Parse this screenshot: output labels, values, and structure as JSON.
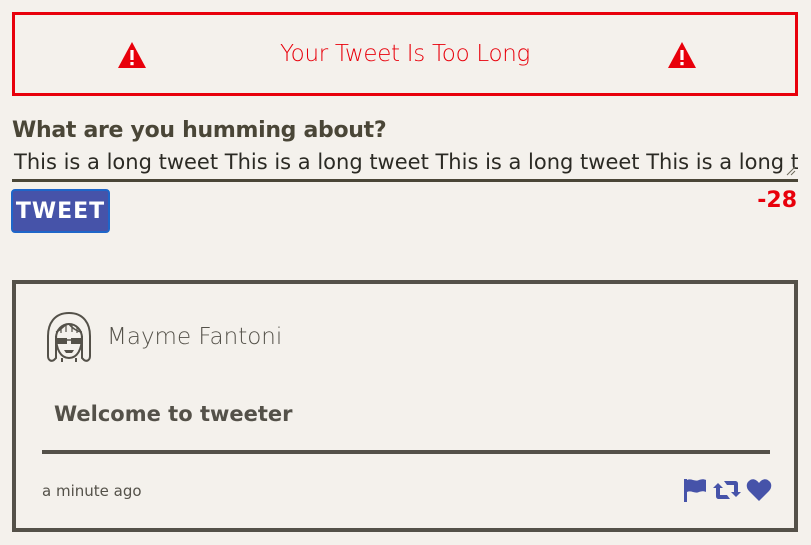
{
  "alert": {
    "message": "Your Tweet Is Too Long",
    "left_icon": "warning-icon",
    "right_icon": "warning-icon",
    "color": "#e8000b"
  },
  "compose": {
    "label": "What are you humming about?",
    "text": "This is a long tweet This is a long tweet This is a long tweet This is a long tweet",
    "button_label": "TWEET",
    "counter": "-28",
    "counter_color": "#e8000b",
    "button_color": "#4653a9"
  },
  "tweet": {
    "avatar_icon": "avatar-icon",
    "username": "Mayme Fantoni",
    "body": "Welcome to tweeter",
    "timestamp": "a minute ago",
    "actions": [
      {
        "name": "flag-icon"
      },
      {
        "name": "retweet-icon"
      },
      {
        "name": "heart-icon"
      }
    ],
    "action_color": "#4653a9"
  }
}
